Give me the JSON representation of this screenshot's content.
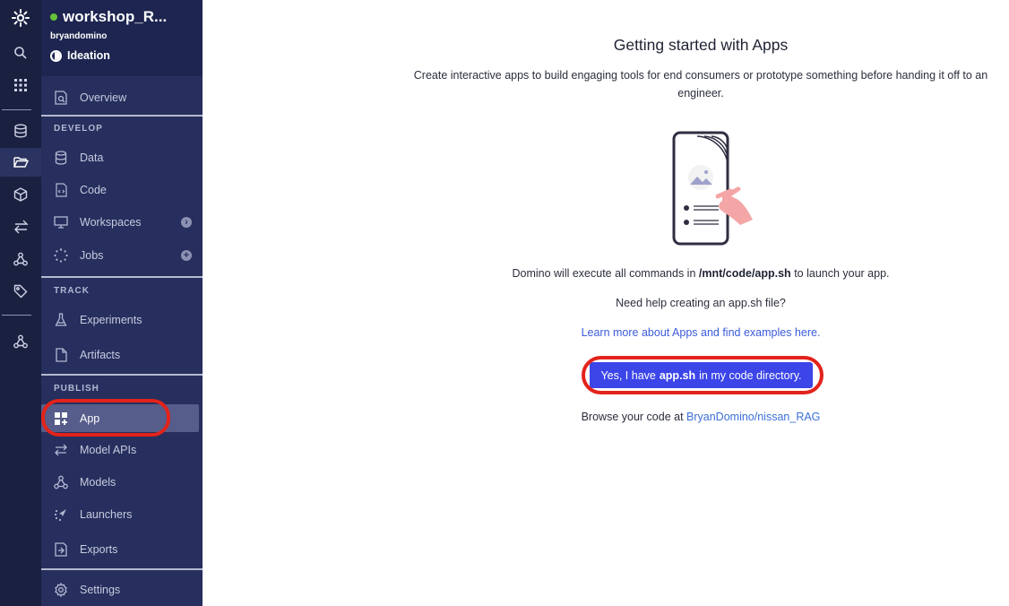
{
  "rail": {
    "icons": [
      "domino-logo-icon",
      "search-icon",
      "apps-grid-icon",
      "database-icon",
      "folder-open-icon",
      "cube-icon",
      "transfer-arrows-icon",
      "model-graph-icon",
      "tag-icon",
      "model-graph-icon"
    ]
  },
  "project": {
    "name": "workshop_R...",
    "owner": "bryandomino",
    "stage": "Ideation",
    "status_color": "#67c23a"
  },
  "sidebar": {
    "overview": "Overview",
    "develop_label": "DEVELOP",
    "data": "Data",
    "code": "Code",
    "workspaces": "Workspaces",
    "jobs": "Jobs",
    "track_label": "TRACK",
    "experiments": "Experiments",
    "artifacts": "Artifacts",
    "publish_label": "PUBLISH",
    "app": "App",
    "model_apis": "Model APIs",
    "models": "Models",
    "launchers": "Launchers",
    "exports": "Exports",
    "settings": "Settings"
  },
  "main": {
    "title": "Getting started with Apps",
    "description": "Create interactive apps to build engaging tools for end consumers or prototype something before handing it off to an engineer.",
    "cmd_prefix": "Domino will execute all commands in",
    "cmd_path": "/mnt/code/app.sh",
    "cmd_suffix": "to launch your app.",
    "help_text": "Need help creating an app.sh file?",
    "learn_link": "Learn more about Apps and find examples here.",
    "cta_prefix": "Yes, I have",
    "cta_bold": "app.sh",
    "cta_suffix": "in my code directory.",
    "browse_prefix": "Browse your code at",
    "browse_link": "BryanDomino/nissan_RAG"
  },
  "colors": {
    "rail_bg": "#1a2040",
    "sidebar_bg": "#262f5d",
    "cta_bg": "#3b45e8",
    "highlight": "#e3231b",
    "link": "#3b5bdb"
  }
}
